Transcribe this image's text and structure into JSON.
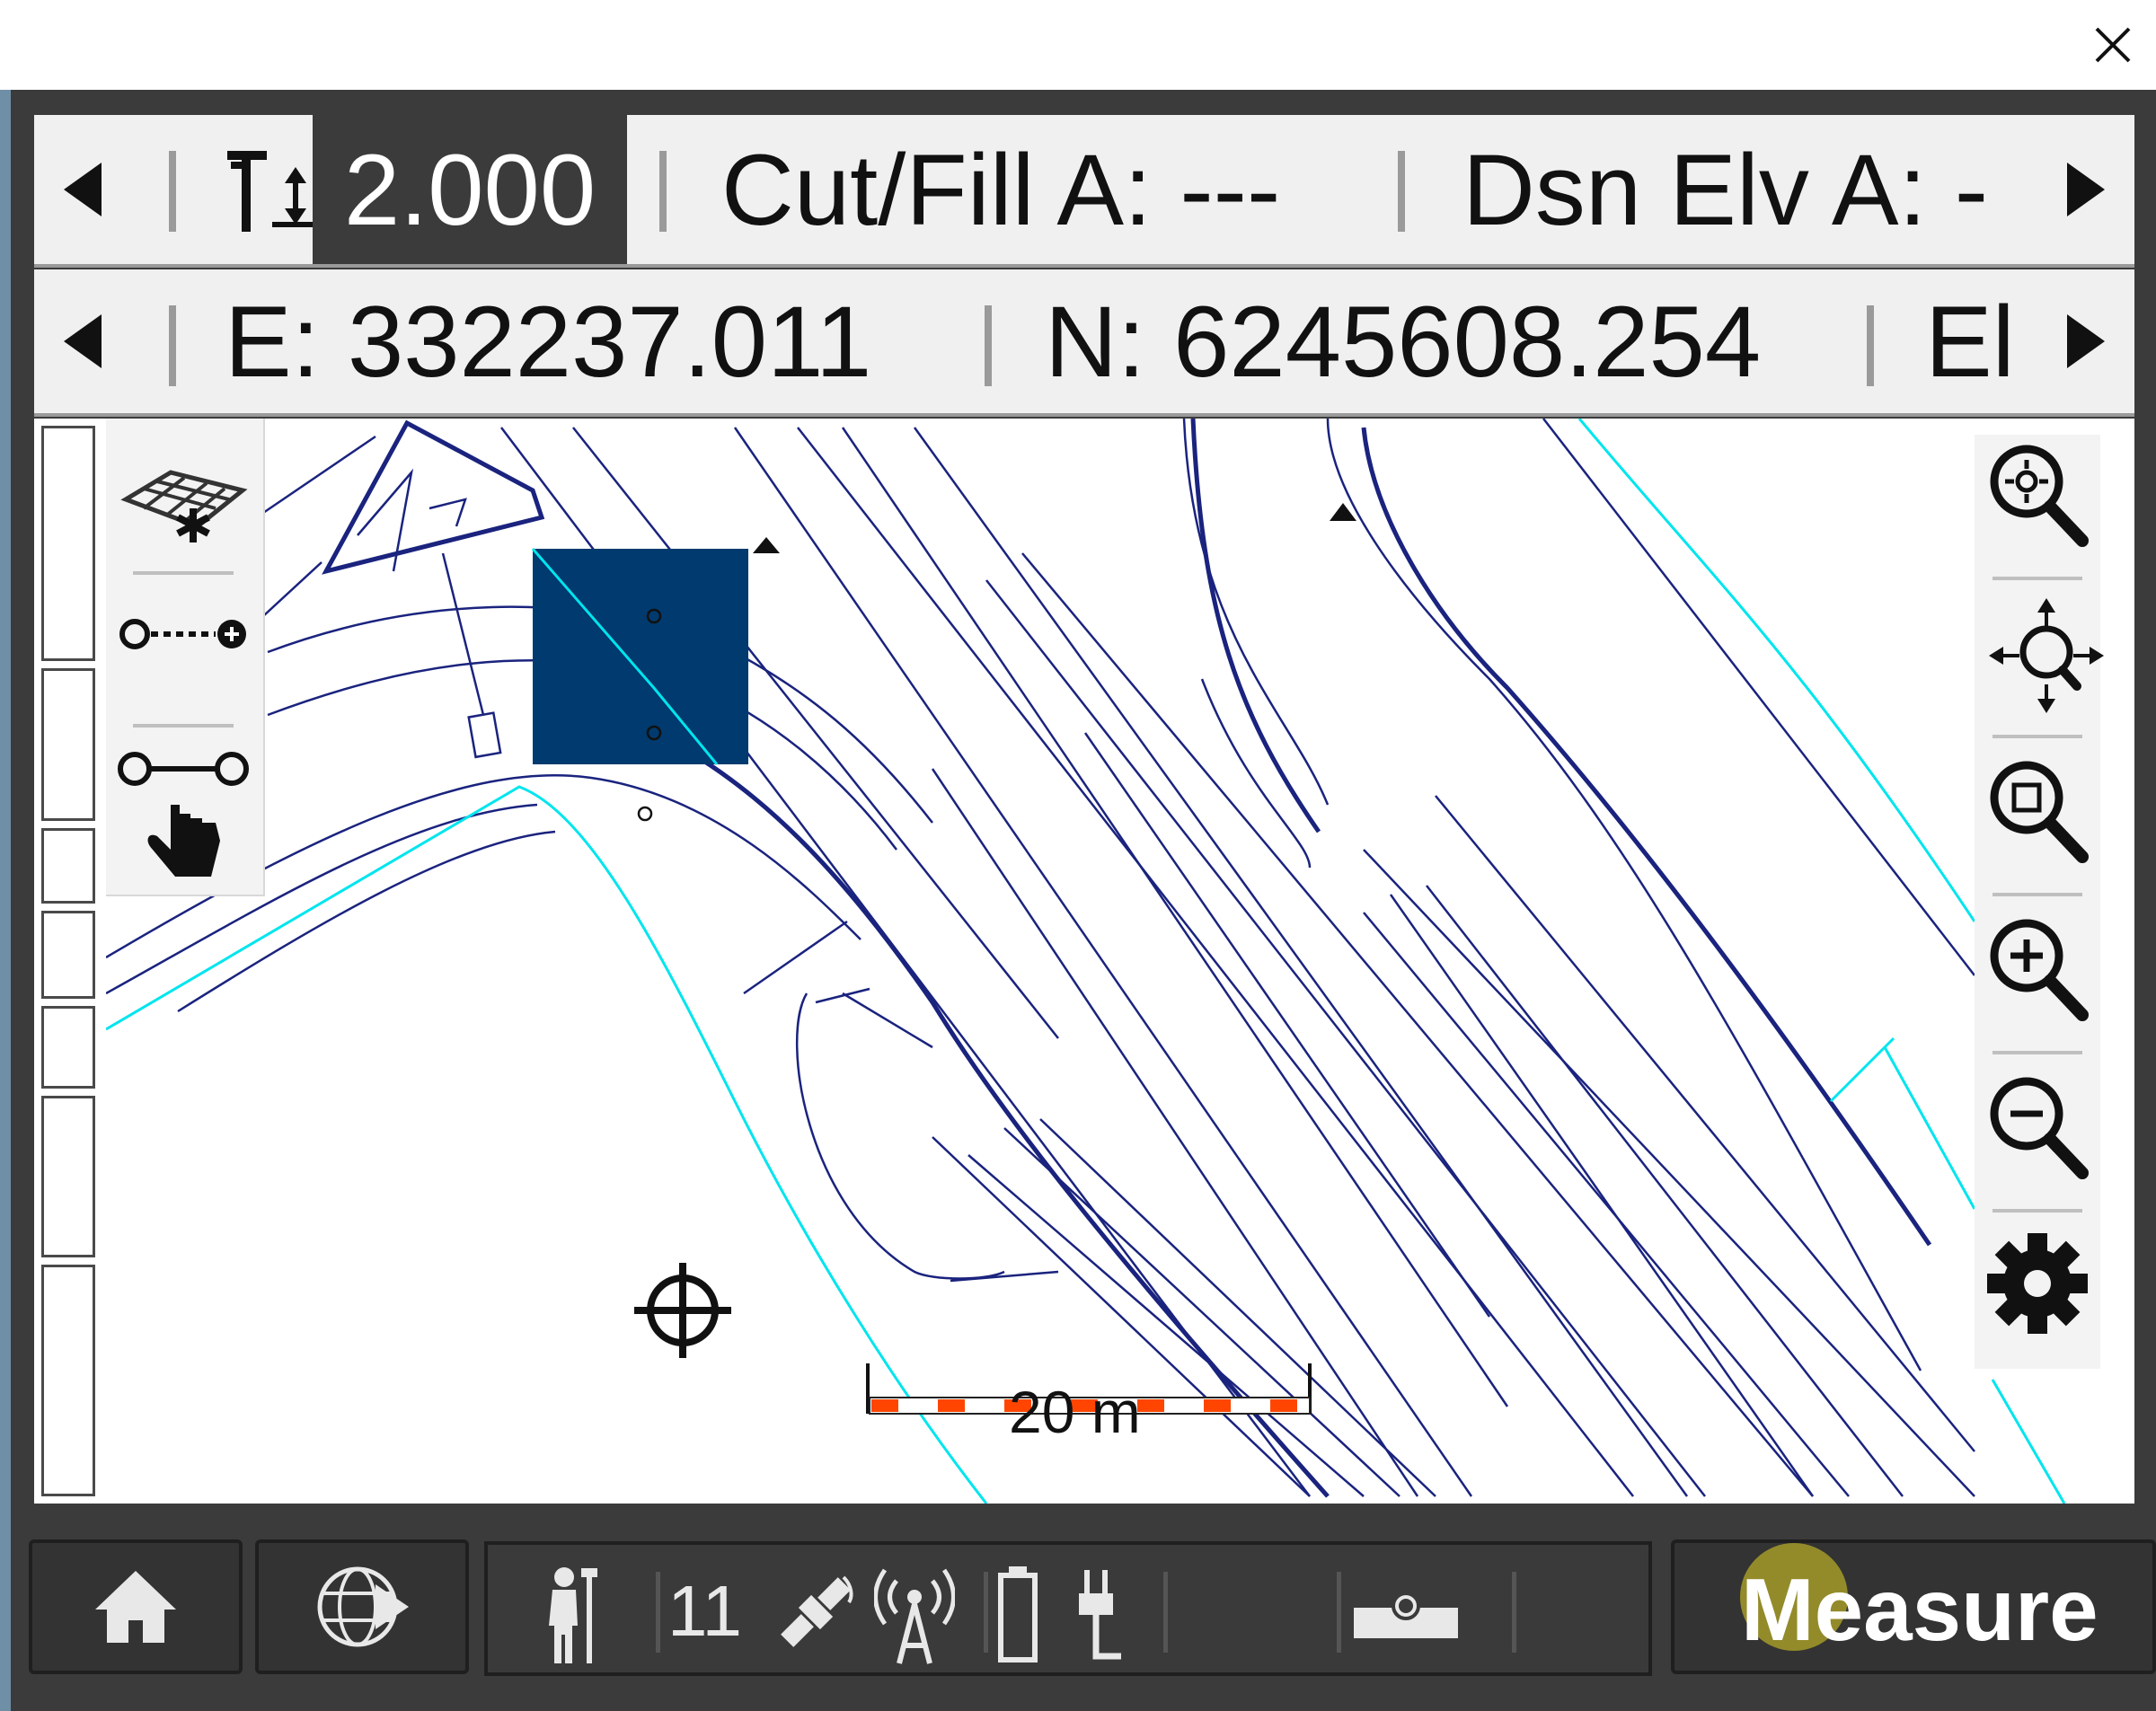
{
  "window": {
    "close_glyph": "×"
  },
  "status_bar_1": {
    "target_height_value": "2.000",
    "cut_fill_text": "Cut/Fill A: ---",
    "design_elevation_text": "Dsn Elv A: -"
  },
  "status_bar_2": {
    "easting_text": "E: 332237.011",
    "northing_text": "N: 6245608.254",
    "elevation_text": "El"
  },
  "map": {
    "scale_bar_label": "20 m",
    "line_color": "#1a237e",
    "boundary_color": "#00e5ee",
    "selected_fill": "#003a6e",
    "scale_bar_color": "#ff4500"
  },
  "map_tools": {
    "left": [
      "surface-select-icon",
      "measure-line-icon",
      "select-line-icon"
    ],
    "right": [
      "zoom-extents-icon",
      "pan-icon",
      "zoom-window-icon",
      "zoom-in-icon",
      "zoom-out-icon",
      "settings-icon"
    ]
  },
  "bottom_bar": {
    "satellite_count": "11",
    "measure_label": "Measure"
  }
}
